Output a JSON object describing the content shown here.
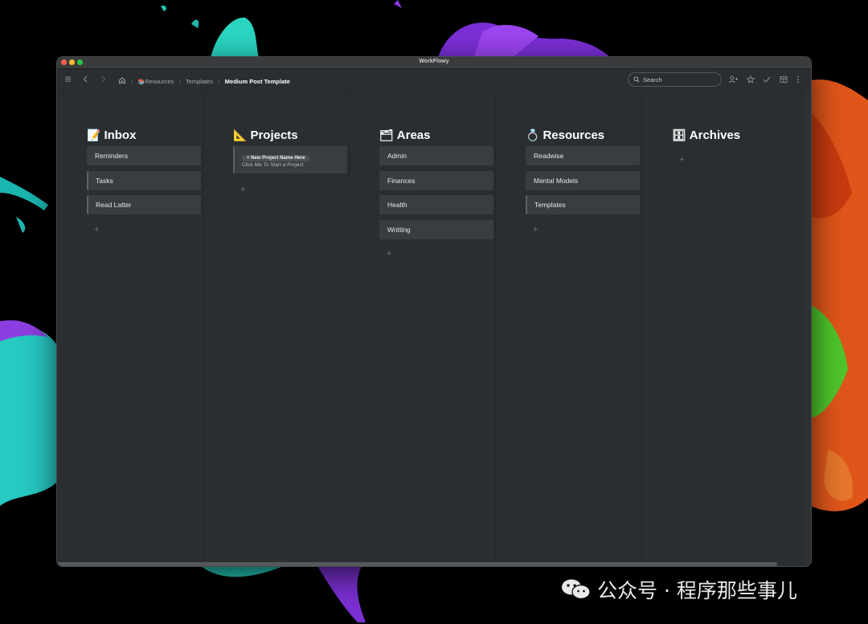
{
  "window": {
    "title": "WorkFlowy"
  },
  "toolbar": {
    "breadcrumb": [
      {
        "label": "Resources",
        "icon": "books-emoji"
      },
      {
        "label": "Templates"
      },
      {
        "label": "Medium Post Template"
      }
    ],
    "search": {
      "placeholder": "Search"
    },
    "icons": [
      "menu-icon",
      "back-icon",
      "forward-icon",
      "home-icon",
      "add-user-icon",
      "star-icon",
      "check-icon",
      "layout-icon",
      "more-icon"
    ]
  },
  "board": {
    "columns": [
      {
        "title": "Inbox",
        "emoji": "📝",
        "items": [
          "Reminders",
          "Tasks",
          "Read Latter"
        ]
      },
      {
        "title": "Projects",
        "emoji": "📐",
        "project_card": {
          "pill": "+ New Project Name Here",
          "note": "Click Me To Start a Project"
        }
      },
      {
        "title": "Areas",
        "emoji": "🗂",
        "items": [
          "Admin",
          "Finances",
          "Health",
          "Writting"
        ]
      },
      {
        "title": "Resources",
        "emoji": "💍",
        "items": [
          "Readwise",
          "Mental Models",
          "Templates"
        ]
      },
      {
        "title": "Archives",
        "emoji": "🗄",
        "items": []
      }
    ],
    "add_symbol": "+"
  },
  "watermark": {
    "text": "公众号 · 程序那些事儿"
  },
  "colors": {
    "window_bg": "#2a2e31",
    "card_bg": "#383d41",
    "text": "#e6e8e9",
    "title": "#ffffff"
  }
}
